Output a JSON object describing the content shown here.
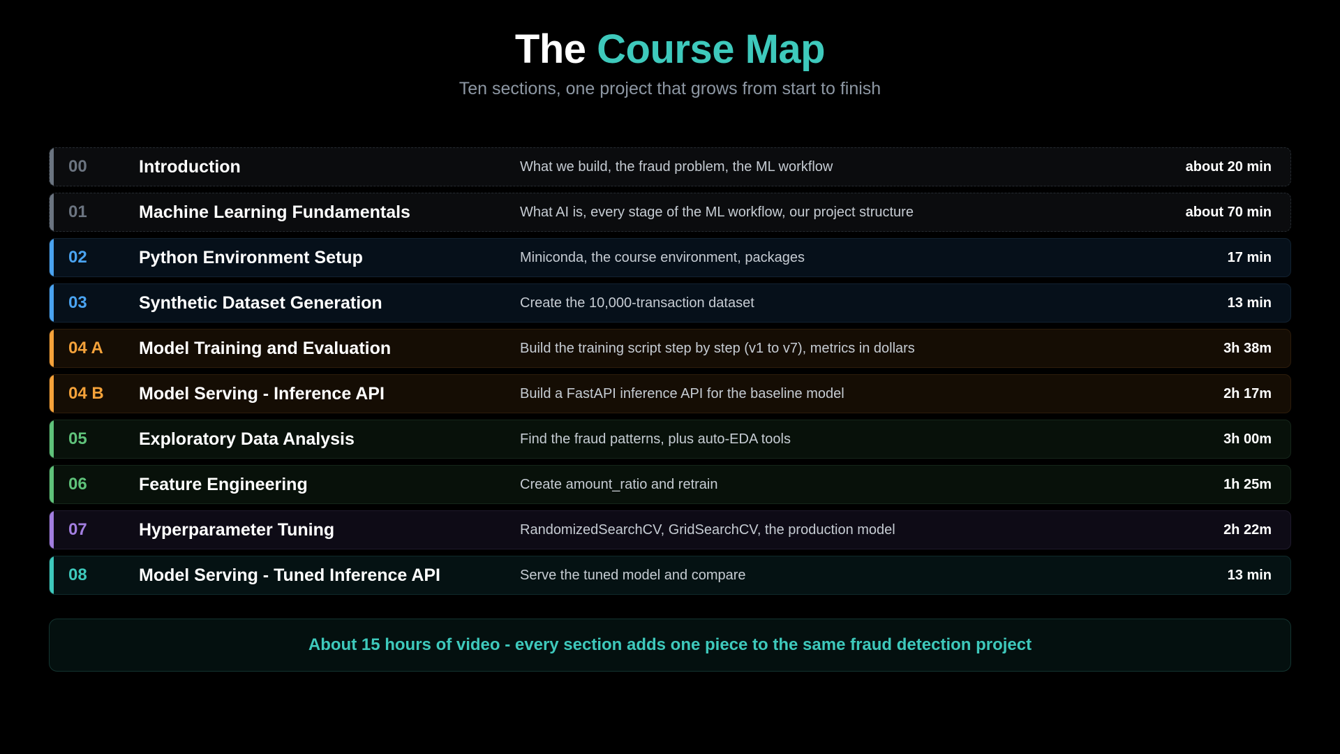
{
  "header": {
    "title_prefix": "The",
    "title_accent": "Course Map",
    "subtitle": "Ten sections, one project that grows from start to finish"
  },
  "colors": {
    "gray": "#6b7480",
    "blue": "#4aa3f0",
    "orange": "#f5a23a",
    "green": "#5fc27a",
    "purple": "#a27ee0",
    "teal": "#3ec9bc"
  },
  "sections": [
    {
      "num": "00",
      "name": "Introduction",
      "desc": "What we build, the fraud problem, the ML workflow",
      "duration": "about 20 min",
      "group": "gray"
    },
    {
      "num": "01",
      "name": "Machine Learning Fundamentals",
      "desc": "What AI is, every stage of the ML workflow, our project structure",
      "duration": "about 70 min",
      "group": "gray"
    },
    {
      "num": "02",
      "name": "Python Environment Setup",
      "desc": "Miniconda, the course environment, packages",
      "duration": "17 min",
      "group": "blue"
    },
    {
      "num": "03",
      "name": "Synthetic Dataset Generation",
      "desc": "Create the 10,000-transaction dataset",
      "duration": "13 min",
      "group": "blue"
    },
    {
      "num": "04 A",
      "name": "Model Training and Evaluation",
      "desc": "Build the training script step by step (v1 to v7), metrics in dollars",
      "duration": "3h 38m",
      "group": "orange"
    },
    {
      "num": "04 B",
      "name": "Model Serving - Inference API",
      "desc": "Build a FastAPI inference API for the baseline model",
      "duration": "2h 17m",
      "group": "orange"
    },
    {
      "num": "05",
      "name": "Exploratory Data Analysis",
      "desc": "Find the fraud patterns, plus auto-EDA tools",
      "duration": "3h 00m",
      "group": "green"
    },
    {
      "num": "06",
      "name": "Feature Engineering",
      "desc": "Create amount_ratio and retrain",
      "duration": "1h 25m",
      "group": "green"
    },
    {
      "num": "07",
      "name": "Hyperparameter Tuning",
      "desc": "RandomizedSearchCV, GridSearchCV, the production model",
      "duration": "2h 22m",
      "group": "purple"
    },
    {
      "num": "08",
      "name": "Model Serving - Tuned Inference API",
      "desc": "Serve the tuned model and compare",
      "duration": "13 min",
      "group": "teal"
    }
  ],
  "footer": {
    "text": "About 15 hours of video - every section adds one piece to the same fraud detection project"
  }
}
